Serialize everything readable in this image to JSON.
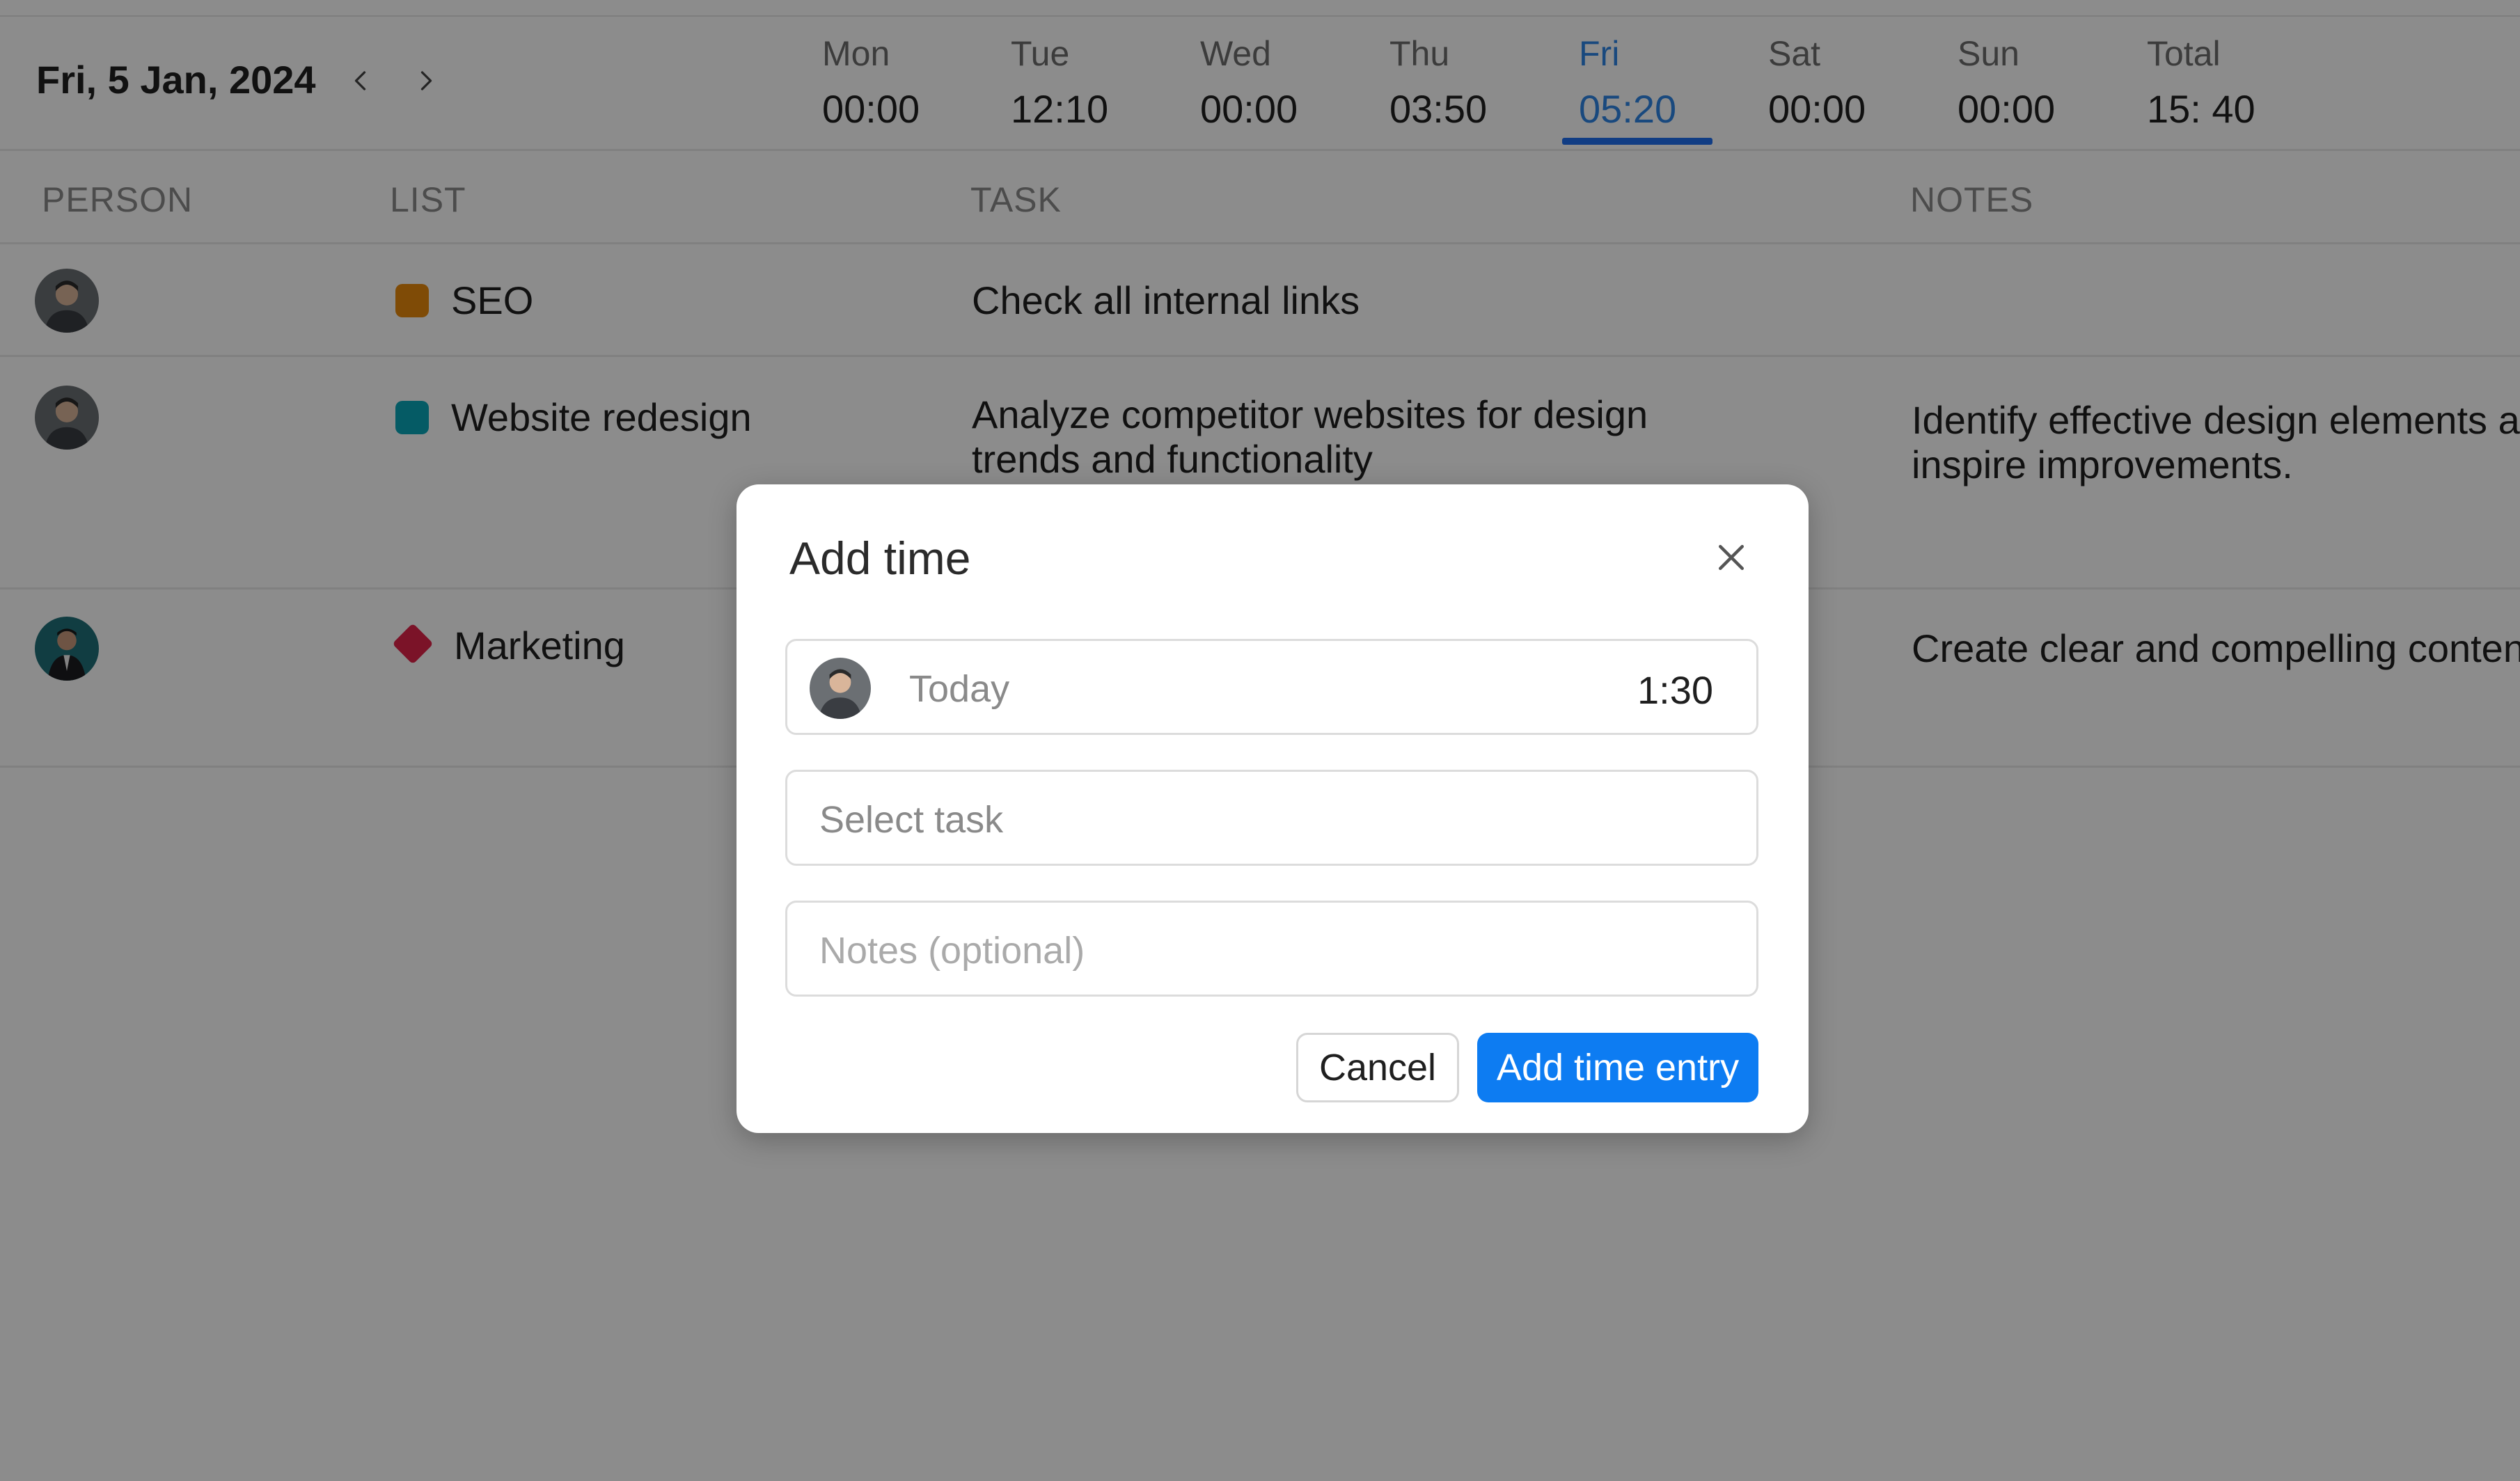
{
  "header": {
    "date_label": "Fri, 5 Jan, 2024",
    "prev_icon": "chevron-left-icon",
    "next_icon": "chevron-right-icon",
    "days": [
      {
        "name": "Mon",
        "value": "00:00"
      },
      {
        "name": "Tue",
        "value": "12:10"
      },
      {
        "name": "Wed",
        "value": "00:00"
      },
      {
        "name": "Thu",
        "value": "03:50"
      },
      {
        "name": "Fri",
        "value": "05:20"
      },
      {
        "name": "Sat",
        "value": "00:00"
      },
      {
        "name": "Sun",
        "value": "00:00"
      },
      {
        "name": "Total",
        "value": "15: 40"
      }
    ],
    "active_day": "Fri"
  },
  "table": {
    "columns": {
      "person": "PERSON",
      "list": "LIST",
      "task": "TASK",
      "notes": "NOTES"
    },
    "rows": [
      {
        "list": "SEO",
        "list_color": "#e8890c",
        "task": "Check all internal links",
        "notes": ""
      },
      {
        "list": "Website redesign",
        "list_color": "#0aa6b8",
        "task_line1": "Analyze competitor websites for design",
        "task_line2": "trends and functionality",
        "notes_line1": "Identify effective design elements a",
        "notes_line2": "inspire improvements."
      },
      {
        "list": "Marketing",
        "list_color": "#e0234a",
        "task": "",
        "notes": "Create clear and compelling conten"
      }
    ]
  },
  "modal": {
    "title": "Add time",
    "close_icon": "close-icon",
    "date_text": "Today",
    "duration": "1:30",
    "task_placeholder": "Select task",
    "notes_placeholder": "Notes (optional)",
    "cancel_label": "Cancel",
    "submit_label": "Add time entry"
  },
  "colors": {
    "accent": "#0d7cf2",
    "active_day_text": "#2f86e6",
    "overlay": "rgba(0,0,0,0.45)"
  }
}
